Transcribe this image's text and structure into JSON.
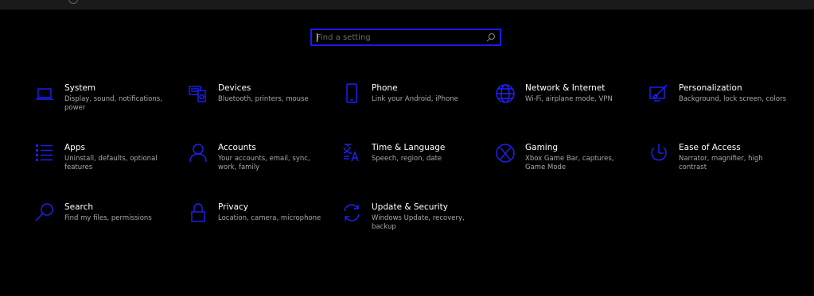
{
  "search": {
    "placeholder": "Find a setting"
  },
  "tiles": [
    {
      "title": "System",
      "desc": "Display, sound, notifications, power",
      "icon": "laptop-icon"
    },
    {
      "title": "Devices",
      "desc": "Bluetooth, printers, mouse",
      "icon": "devices-icon"
    },
    {
      "title": "Phone",
      "desc": "Link your Android, iPhone",
      "icon": "phone-icon"
    },
    {
      "title": "Network & Internet",
      "desc": "Wi-Fi, airplane mode, VPN",
      "icon": "globe-icon"
    },
    {
      "title": "Personalization",
      "desc": "Background, lock screen, colors",
      "icon": "paint-icon"
    },
    {
      "title": "Apps",
      "desc": "Uninstall, defaults, optional features",
      "icon": "apps-list-icon"
    },
    {
      "title": "Accounts",
      "desc": "Your accounts, email, sync, work, family",
      "icon": "person-icon"
    },
    {
      "title": "Time & Language",
      "desc": "Speech, region, date",
      "icon": "time-language-icon"
    },
    {
      "title": "Gaming",
      "desc": "Xbox Game Bar, captures, Game Mode",
      "icon": "xbox-icon"
    },
    {
      "title": "Ease of Access",
      "desc": "Narrator, magnifier, high contrast",
      "icon": "ease-of-access-icon"
    },
    {
      "title": "Search",
      "desc": "Find my files, permissions",
      "icon": "search-icon"
    },
    {
      "title": "Privacy",
      "desc": "Location, camera, microphone",
      "icon": "lock-icon"
    },
    {
      "title": "Update & Security",
      "desc": "Windows Update, recovery, backup",
      "icon": "sync-icon"
    }
  ],
  "colors": {
    "accent": "#2020ff",
    "background": "#000000",
    "text": "#ffffff",
    "subtext": "#a8a8a8"
  }
}
